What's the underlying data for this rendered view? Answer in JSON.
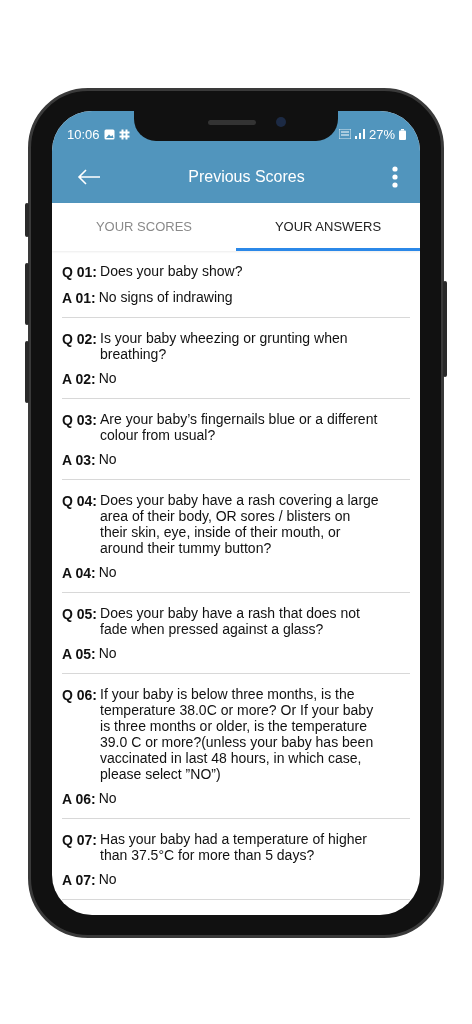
{
  "status_bar": {
    "time": "10:06",
    "battery": "27%"
  },
  "app_bar": {
    "title": "Previous Scores"
  },
  "tabs": [
    {
      "label": "YOUR SCORES",
      "selected": false
    },
    {
      "label": "YOUR ANSWERS",
      "selected": true
    }
  ],
  "answers": [
    {
      "q_label": "Q 01:",
      "question": "Does your baby show?",
      "a_label": "A 01:",
      "answer": "No signs of indrawing"
    },
    {
      "q_label": "Q 02:",
      "question": "Is your baby wheezing or grunting when breathing?",
      "a_label": "A 02:",
      "answer": "No"
    },
    {
      "q_label": "Q 03:",
      "question": "Are your baby’s fingernails blue or a different colour from usual?",
      "a_label": "A 03:",
      "answer": "No"
    },
    {
      "q_label": "Q 04:",
      "question": "Does your baby have a rash covering a large area of their body, OR sores / blisters on their skin, eye, inside of their mouth, or around their tummy button?",
      "a_label": "A 04:",
      "answer": "No"
    },
    {
      "q_label": "Q 05:",
      "question": "Does your baby have a rash that does not fade when pressed against a glass?",
      "a_label": "A 05:",
      "answer": "No"
    },
    {
      "q_label": "Q 06:",
      "question": "If your baby is below three months, is the temperature 38.0C or more? Or If your baby is three months or older, is the temperature 39.0 C or more?(unless your baby has been vaccinated in last 48 hours, in which case, please select ”NO”)",
      "a_label": "A 06:",
      "answer": "No"
    },
    {
      "q_label": "Q 07:",
      "question": "Has your baby had a temperature of higher than 37.5°C for more than 5 days?",
      "a_label": "A 07:",
      "answer": "No"
    }
  ]
}
